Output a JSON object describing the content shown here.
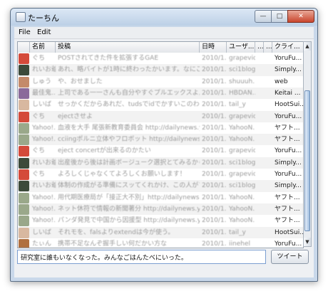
{
  "window": {
    "title": "たーちん",
    "icon": "app-icon"
  },
  "window_controls": {
    "minimize": "—",
    "maximize": "□",
    "close": "✕"
  },
  "menu": {
    "items": [
      "File",
      "Edit"
    ]
  },
  "table": {
    "columns": [
      "名前",
      "投稿",
      "日時",
      "ユーザ...",
      "...",
      "...",
      "クライ..."
    ],
    "rows": [
      {
        "avatar": "#d44a3a",
        "name": "ぐち",
        "post": "POSTされてきた件を拡張するGAE",
        "time": "2010/1...",
        "user": "grapevid",
        "client": "YoruFu..."
      },
      {
        "avatar": "#3c4a3a",
        "name": "れいお爺",
        "post": "あれ、略バイトが1時に終わったかいます。なにこれ、…",
        "time": "2010/1...",
        "user": "sci1blog",
        "client": "Simply..."
      },
      {
        "avatar": "#c48a6a",
        "name": "しゅう",
        "post": "や、おせました",
        "time": "2010/1...",
        "user": "shuuuh...",
        "client": "web"
      },
      {
        "avatar": "#8a6a9a",
        "name": "最佳鬼...",
        "post": "上司である一一さんも自分やすぐプルエックスよんんでいま…",
        "time": "2010/1...",
        "user": "HBDAN...",
        "client": "Keitai ..."
      },
      {
        "avatar": "#d8b8a0",
        "name": "しいば",
        "post": "せっかくだからあれだ、tudsでidでかすいこのわけ、よかった…",
        "time": "2010/1...",
        "user": "tail_y",
        "client": "HootSui..."
      },
      {
        "avatar": "#d44a3a",
        "name": "ぐち",
        "post": "ejectさせよ",
        "time": "2010/1...",
        "user": "grapevid",
        "client": "YoruFu..."
      },
      {
        "avatar": "#9aa88a",
        "name": "Yahoo!...",
        "post": "血液を大手 尾張新教育委員会 http://dailynews.yahoo.co.j...",
        "time": "2010/1...",
        "user": "YahooN...",
        "client": "ヤフト..."
      },
      {
        "avatar": "#9aa88a",
        "name": "Yahoo!...",
        "post": "cciingポルニ立体やフロボット http://dailynews.yahoo.co.j...",
        "time": "2010/1...",
        "user": "YahooN...",
        "client": "ヤフト..."
      },
      {
        "avatar": "#d44a3a",
        "name": "ぐち",
        "post": "eject concertが出来るのかたい",
        "time": "2010/1...",
        "user": "grapevid",
        "client": "YoruFu..."
      },
      {
        "avatar": "#3c4a3a",
        "name": "れいお爺",
        "post": "出産後から後は計画ボージューク選択とてみるから",
        "time": "2010/1...",
        "user": "sci1blog",
        "client": "Simply..."
      },
      {
        "avatar": "#d44a3a",
        "name": "ぐち",
        "post": "よろしくじゃなくてよろしくお願いします！",
        "time": "2010/1...",
        "user": "grapevid",
        "client": "YoruFu..."
      },
      {
        "avatar": "#3c4a3a",
        "name": "れいお爺",
        "post": "体制の作成がる準備にスッてくれかけ、この人がプレイす…",
        "time": "2010/1...",
        "user": "sci1blog",
        "client": "Simply..."
      },
      {
        "avatar": "#9aa88a",
        "name": "Yahoo!...",
        "post": "用代期医療局が「接正大不別」http://dailynews.yahoo.co...",
        "time": "2010/1...",
        "user": "YahooN...",
        "client": "ヤフト..."
      },
      {
        "avatar": "#9aa88a",
        "name": "Yahoo!...",
        "post": "ネット休符で情報の新聞著分 http://dailynews.yahoo.co.j...",
        "time": "2010/1...",
        "user": "YahooN...",
        "client": "ヤフト..."
      },
      {
        "avatar": "#9aa88a",
        "name": "Yahoo!...",
        "post": "パンダ発見で中国から因援型 http://dailynews.yahoo.co.j...",
        "time": "2010/1...",
        "user": "YahooN...",
        "client": "ヤフト..."
      },
      {
        "avatar": "#d8b8a0",
        "name": "しいば",
        "post": "それモを、falsよりextendは今が使う。",
        "time": "2010/1...",
        "user": "tail_y",
        "client": "HootSui..."
      },
      {
        "avatar": "#b07040",
        "name": "たぃん",
        "post": "携帯不足なんぞ握手しい何だかい方な",
        "time": "2010/1...",
        "user": "iinehel",
        "client": "YoruFu..."
      }
    ]
  },
  "compose": {
    "value": "研究室に誰もいなくなった。みんなごはんたべにいった。",
    "button_label": "ツイート"
  }
}
